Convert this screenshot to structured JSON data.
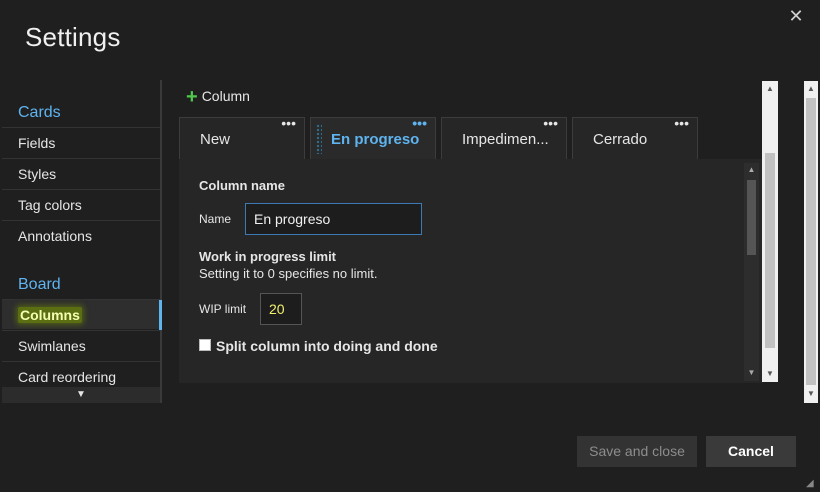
{
  "dialog": {
    "title": "Settings",
    "close_glyph": "✕"
  },
  "nav": {
    "sections": [
      {
        "header": "Cards",
        "items": [
          "Fields",
          "Styles",
          "Tag colors",
          "Annotations"
        ]
      },
      {
        "header": "Board",
        "items": [
          "Columns",
          "Swimlanes",
          "Card reordering"
        ]
      }
    ],
    "selected_item": "Columns",
    "scroll_down_glyph": "▼"
  },
  "toolbar": {
    "add_column_label": "Column",
    "add_icon_glyph": "+"
  },
  "tabs": [
    {
      "label": "New",
      "menu_glyph": "•••"
    },
    {
      "label": "En progreso",
      "menu_glyph": "•••",
      "active": true
    },
    {
      "label": "Impedimen...",
      "menu_glyph": "•••"
    },
    {
      "label": "Cerrado",
      "menu_glyph": "•••"
    }
  ],
  "form": {
    "column_name_heading": "Column name",
    "name_label": "Name",
    "name_value": "En progreso",
    "wip_heading": "Work in progress limit",
    "wip_description": "Setting it to 0 specifies no limit.",
    "wip_label": "WIP limit",
    "wip_value": "20",
    "split_label": "Split column into doing and done",
    "split_checked": false
  },
  "footer": {
    "save_label": "Save and close",
    "cancel_label": "Cancel"
  },
  "colors": {
    "accent": "#5fb4f0",
    "add_icon": "#4ec94e",
    "wip_value": "#f0f070"
  }
}
